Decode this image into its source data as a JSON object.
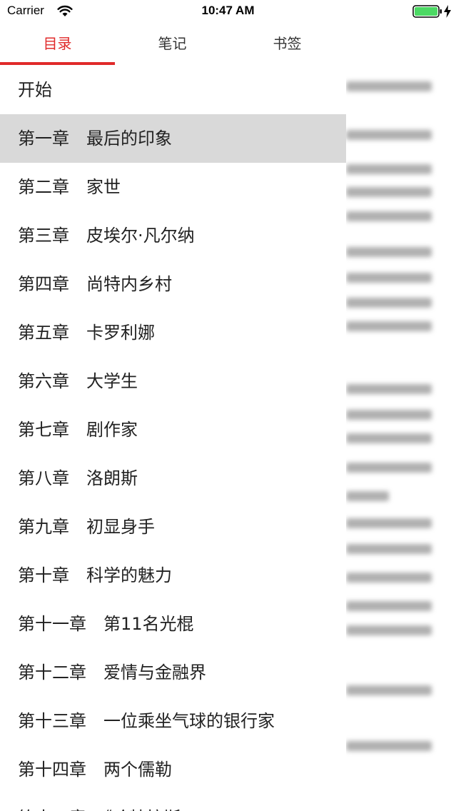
{
  "status_bar": {
    "carrier": "Carrier",
    "time": "10:47 AM",
    "battery_color": "#4cd964"
  },
  "tabs": [
    {
      "label": "目录",
      "active": true
    },
    {
      "label": "笔记",
      "active": false
    },
    {
      "label": "书签",
      "active": false
    }
  ],
  "accent_color": "#e02a2a",
  "toc": [
    {
      "text": "开始",
      "selected": false
    },
    {
      "text": "第一章　最后的印象",
      "selected": true
    },
    {
      "text": "第二章　家世",
      "selected": false
    },
    {
      "text": "第三章　皮埃尔·凡尔纳",
      "selected": false
    },
    {
      "text": "第四章　尚特内乡村",
      "selected": false
    },
    {
      "text": "第五章　卡罗利娜",
      "selected": false
    },
    {
      "text": "第六章　大学生",
      "selected": false
    },
    {
      "text": "第七章　剧作家",
      "selected": false
    },
    {
      "text": "第八章　洛朗斯",
      "selected": false
    },
    {
      "text": "第九章　初显身手",
      "selected": false
    },
    {
      "text": "第十章　科学的魅力",
      "selected": false
    },
    {
      "text": "第十一章　第11名光棍",
      "selected": false
    },
    {
      "text": "第十二章　爱情与金融界",
      "selected": false
    },
    {
      "text": "第十三章　一位乘坐气球的银行家",
      "selected": false
    },
    {
      "text": "第十四章　两个儒勒",
      "selected": false
    },
    {
      "text": "第十五章　《哈特拉斯",
      "selected": false
    }
  ]
}
